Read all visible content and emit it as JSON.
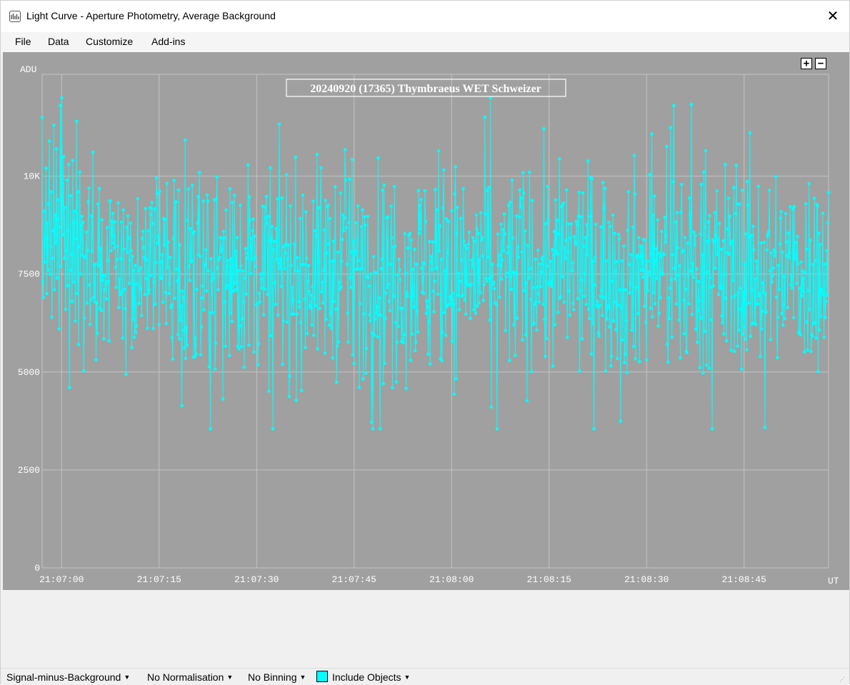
{
  "window": {
    "title": "Light Curve - Aperture Photometry, Average Background",
    "close_symbol": "✕",
    "icon": "light-curve-app-icon"
  },
  "menu": [
    {
      "label": "File"
    },
    {
      "label": "Data"
    },
    {
      "label": "Customize"
    },
    {
      "label": "Add-ins"
    }
  ],
  "toolbar": {
    "zoom_in_label": "+",
    "zoom_out_label": "−"
  },
  "status_bar": {
    "mode_label": "Signal-minus-Background",
    "normalisation_label": "No Normalisation",
    "binning_label": "No Binning",
    "objects_label": "Include Objects",
    "swatch_color": "#00ffff",
    "dropdown_arrow": "▼"
  },
  "colors": {
    "plot_background": "#a0a0a0",
    "grid": "#c4c4c4",
    "series": "#00ffff",
    "text": "#ffffff"
  },
  "chart_data": {
    "type": "line",
    "title": "20240920 (17365) Thymbraeus WET Schweizer",
    "xlabel": "UT",
    "ylabel": "ADU",
    "x_start": "21:06:57",
    "x_end": "21:08:58",
    "y_ticks": [
      {
        "value": 0,
        "label": "0"
      },
      {
        "value": 2500,
        "label": "2500"
      },
      {
        "value": 5000,
        "label": "5000"
      },
      {
        "value": 7500,
        "label": "7500"
      },
      {
        "value": 10000,
        "label": "10K"
      }
    ],
    "x_ticks": [
      {
        "t": "21:07:00"
      },
      {
        "t": "21:07:15"
      },
      {
        "t": "21:07:30"
      },
      {
        "t": "21:07:45"
      },
      {
        "t": "21:08:00"
      },
      {
        "t": "21:08:15"
      },
      {
        "t": "21:08:30"
      },
      {
        "t": "21:08:45"
      }
    ],
    "ylim": [
      0,
      12600
    ],
    "grid": true,
    "series": [
      {
        "marker": "dot",
        "sample_interval_s": 0.1,
        "value_range": [
          3550,
          12000
        ],
        "typical_range": [
          6000,
          9000
        ],
        "values": [
          11500,
          7300,
          6900,
          9100,
          7800,
          8400,
          10200,
          7000,
          8800,
          7600,
          9300,
          10900,
          7500,
          8200,
          9600,
          6400,
          7900,
          8600,
          11300,
          7100,
          9000,
          8300,
          10700,
          7400,
          8900,
          9400,
          6100,
          8700,
          11800,
          7700,
          12000,
          9800,
          8500,
          10500,
          7900,
          9200,
          6600,
          8100,
          9900,
          7200,
          8600,
          10300,
          4600,
          7600,
          9500,
          8000,
          6800,
          10400,
          7300,
          8800,
          9100,
          6300,
          8400,
          11400,
          7000,
          9600,
          5700,
          8200,
          10100,
          7500
        ]
      }
    ],
    "mean_level": 7600
  }
}
